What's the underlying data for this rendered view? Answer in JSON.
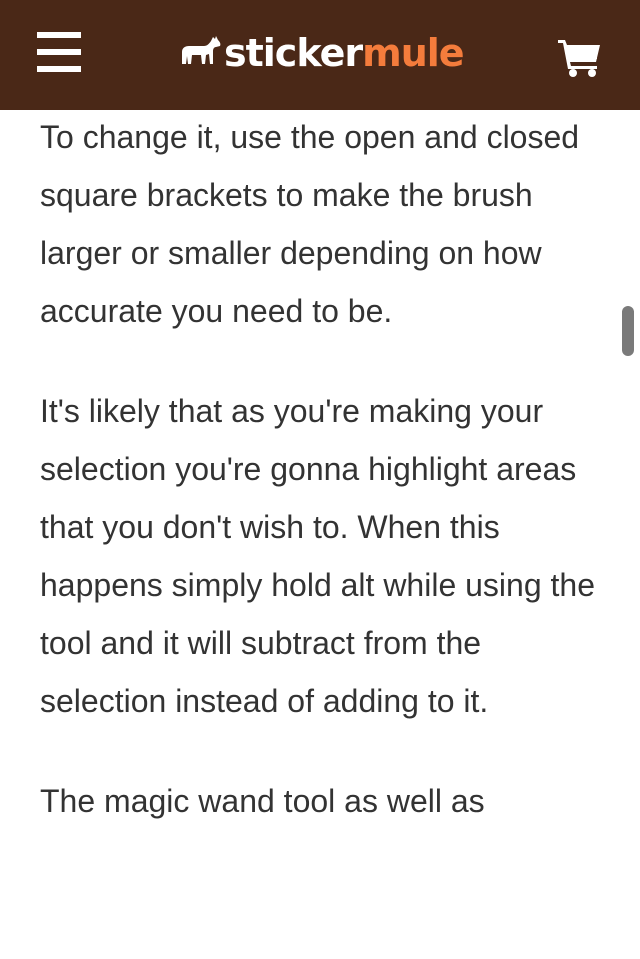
{
  "header": {
    "logo_sticker": "sticker",
    "logo_mule": "mule",
    "brand_color": "#4a2817",
    "accent_color": "#f47c3c",
    "menu_icon": "hamburger-menu-icon",
    "cart_icon": "shopping-cart-icon"
  },
  "article": {
    "paragraphs": [
      "To change it, use the open and closed square brackets to make the brush larger or smaller depending on how accurate you need to be.",
      "It's likely that as you're making your selection you're gonna highlight areas that you don't wish to. When this happens simply hold alt while using the tool and it will subtract from the selection instead of adding to it.",
      "The magic wand tool as well as"
    ]
  }
}
